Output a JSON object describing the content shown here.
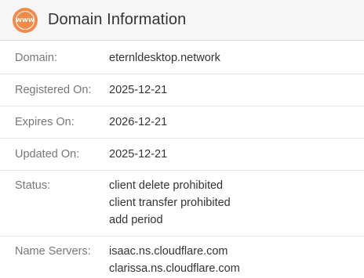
{
  "header": {
    "icon_text": "WWW",
    "icon_name": "www-globe-icon",
    "icon_color": "#f08a4b",
    "title": "Domain Information"
  },
  "rows": [
    {
      "label": "Domain:",
      "values": [
        "eternldesktop.network"
      ]
    },
    {
      "label": "Registered On:",
      "values": [
        "2025-12-21"
      ]
    },
    {
      "label": "Expires On:",
      "values": [
        "2026-12-21"
      ]
    },
    {
      "label": "Updated On:",
      "values": [
        "2025-12-21"
      ]
    },
    {
      "label": "Status:",
      "values": [
        "client delete prohibited",
        "client transfer prohibited",
        "add period"
      ]
    },
    {
      "label": "Name Servers:",
      "values": [
        "isaac.ns.cloudflare.com",
        "clarissa.ns.cloudflare.com"
      ]
    }
  ]
}
